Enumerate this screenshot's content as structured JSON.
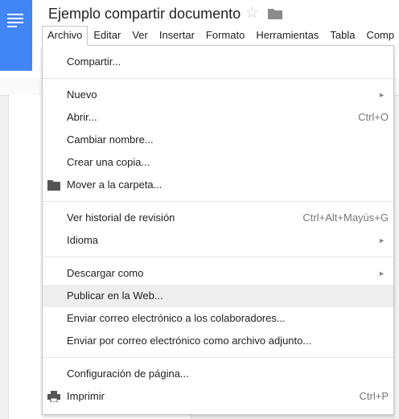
{
  "app": {
    "icon": "docs-logo-icon"
  },
  "document": {
    "title": "Ejemplo compartir documento",
    "star_icon": "star-icon",
    "folder_icon": "folder-icon"
  },
  "menubar": {
    "items": [
      {
        "label": "Archivo"
      },
      {
        "label": "Editar"
      },
      {
        "label": "Ver"
      },
      {
        "label": "Insertar"
      },
      {
        "label": "Formato"
      },
      {
        "label": "Herramientas"
      },
      {
        "label": "Tabla"
      },
      {
        "label": "Comp"
      }
    ]
  },
  "file_menu": {
    "share": "Compartir...",
    "new": "Nuevo",
    "open": "Abrir...",
    "open_shortcut": "Ctrl+O",
    "rename": "Cambiar nombre...",
    "copy": "Crear una copia...",
    "move": "Mover a la carpeta...",
    "history": "Ver historial de revisión",
    "history_shortcut": "Ctrl+Alt+Mayús+G",
    "language": "Idioma",
    "download": "Descargar como",
    "publish": "Publicar en la Web...",
    "email_collaborators": "Enviar correo electrónico a los colaboradores...",
    "email_attachment": "Enviar por correo electrónico como archivo adjunto...",
    "page_setup": "Configuración de página...",
    "print": "Imprimir",
    "print_shortcut": "Ctrl+P",
    "submenu_arrow": "►"
  },
  "colors": {
    "brand": "#4285f4",
    "highlight": "#eeeeee"
  }
}
